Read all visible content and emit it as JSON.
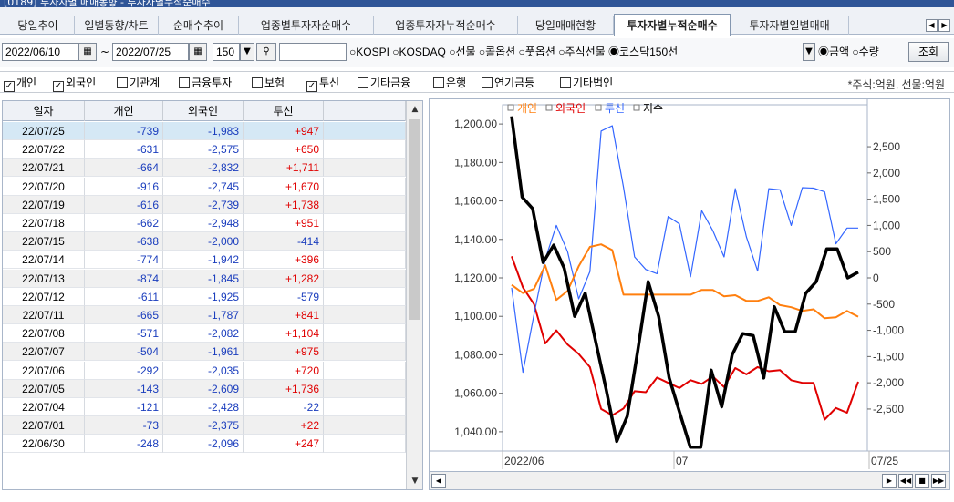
{
  "window": {
    "title": "[0189] 투자자별 매매동향 - 투자자별누적순매수"
  },
  "tabs": [
    "당일추이",
    "일별동향/차트",
    "순매수추이",
    "업종별투자자순매수",
    "업종투자자누적순매수",
    "당일매매현황",
    "투자자별누적순매수",
    "투자자별일별매매"
  ],
  "active_tab": 6,
  "toolbar": {
    "start_date": "2022/06/10",
    "tilde": "~",
    "end_date": "2022/07/25",
    "count": "150",
    "code_input": "",
    "radio_options": "○KOSPI ○KOSDAQ ○선물 ○콜옵션 ○풋옵션 ○주식선물 ◉코스닥150선",
    "amount_radio": "◉금액 ○수량",
    "search_button": "조회"
  },
  "filters": [
    {
      "label": "개인",
      "checked": true
    },
    {
      "label": "외국인",
      "checked": true
    },
    {
      "label": "기관계",
      "checked": false
    },
    {
      "label": "금융투자",
      "checked": false
    },
    {
      "label": "보험",
      "checked": false
    },
    {
      "label": "투신",
      "checked": true
    },
    {
      "label": "기타금융",
      "checked": false
    },
    {
      "label": "은행",
      "checked": false
    },
    {
      "label": "연기금등",
      "checked": false
    },
    {
      "label": "기타법인",
      "checked": false
    }
  ],
  "unit_note": "*주식:억원, 선물:억원",
  "table": {
    "headers": [
      "일자",
      "개인",
      "외국인",
      "투신"
    ],
    "rows": [
      [
        "22/07/25",
        "-739",
        "-1,983",
        "+947"
      ],
      [
        "22/07/22",
        "-631",
        "-2,575",
        "+650"
      ],
      [
        "22/07/21",
        "-664",
        "-2,832",
        "+1,711"
      ],
      [
        "22/07/20",
        "-916",
        "-2,745",
        "+1,670"
      ],
      [
        "22/07/19",
        "-616",
        "-2,739",
        "+1,738"
      ],
      [
        "22/07/18",
        "-662",
        "-2,948",
        "+951"
      ],
      [
        "22/07/15",
        "-638",
        "-2,000",
        "-414"
      ],
      [
        "22/07/14",
        "-774",
        "-1,942",
        "+396"
      ],
      [
        "22/07/13",
        "-874",
        "-1,845",
        "+1,282"
      ],
      [
        "22/07/12",
        "-611",
        "-1,925",
        "-579"
      ],
      [
        "22/07/11",
        "-665",
        "-1,787",
        "+841"
      ],
      [
        "22/07/08",
        "-571",
        "-2,082",
        "+1,104"
      ],
      [
        "22/07/07",
        "-504",
        "-1,961",
        "+975"
      ],
      [
        "22/07/06",
        "-292",
        "-2,035",
        "+720"
      ],
      [
        "22/07/05",
        "-143",
        "-2,609",
        "+1,736"
      ],
      [
        "22/07/04",
        "-121",
        "-2,428",
        "-22"
      ],
      [
        "22/07/01",
        "-73",
        "-2,375",
        "+22"
      ],
      [
        "22/06/30",
        "-248",
        "-2,096",
        "+247"
      ]
    ]
  },
  "chart_data": {
    "type": "line",
    "legend": [
      "개인",
      "외국인",
      "투신",
      "지수"
    ],
    "colors": {
      "개인": "#ff7f0e",
      "외국인": "#e00000",
      "투신": "#3366ff",
      "지수": "#000000"
    },
    "left_axis": {
      "ticks": [
        "1,200.00",
        "1,180.00",
        "1,160.00",
        "1,140.00",
        "1,120.00",
        "1,100.00",
        "1,080.00",
        "1,060.00",
        "1,040.00"
      ],
      "range": [
        1030,
        1210
      ]
    },
    "right_axis": {
      "ticks": [
        "2,500",
        "2,000",
        "1,500",
        "1,000",
        "500",
        "0",
        "-500",
        "-1,000",
        "-1,500",
        "-2,000",
        "-2,500"
      ],
      "range": [
        -3300,
        3300
      ]
    },
    "x_labels": [
      "2022/06",
      "07",
      "07/25"
    ],
    "points": 32,
    "series": [
      {
        "name": "지수",
        "axis": "left",
        "values": [
          1204,
          1162,
          1156,
          1128,
          1137,
          1125,
          1100,
          1112,
          1087,
          1062,
          1035,
          1048,
          1082,
          1118,
          1100,
          1068,
          1050,
          1032,
          1032,
          1072,
          1053,
          1080,
          1091,
          1090,
          1068,
          1105,
          1092,
          1092,
          1112,
          1118,
          1135,
          1135,
          1120,
          1123
        ]
      },
      {
        "name": "개인",
        "axis": "left_series_as_right",
        "values": [
          -134,
          -290,
          -210,
          240,
          -420,
          -250,
          220,
          590,
          640,
          530,
          -320,
          -320,
          -320,
          -320,
          -320,
          -320,
          -320,
          -230,
          -230,
          -350,
          -330,
          -440,
          -440,
          -370,
          -520,
          -560,
          -630,
          -600,
          -770,
          -750,
          -630,
          -740
        ]
      },
      {
        "name": "외국인",
        "axis": "right",
        "values": [
          410,
          -180,
          -500,
          -1250,
          -1000,
          -1270,
          -1450,
          -1700,
          -2500,
          -2620,
          -2490,
          -2160,
          -2180,
          -1900,
          -2000,
          -2100,
          -1950,
          -2020,
          -1880,
          -2080,
          -1720,
          -1840,
          -1700,
          -1780,
          -1760,
          -1950,
          -2000,
          -2000,
          -2700,
          -2480,
          -2570,
          -1980
        ]
      },
      {
        "name": "투신",
        "axis": "right",
        "values": [
          -190,
          -1800,
          -700,
          350,
          1000,
          500,
          -400,
          120,
          2800,
          2900,
          1730,
          400,
          160,
          80,
          1170,
          1030,
          20,
          1280,
          900,
          400,
          1700,
          780,
          130,
          1700,
          1680,
          1000,
          1720,
          1710,
          1640,
          650,
          950,
          950
        ]
      }
    ]
  }
}
